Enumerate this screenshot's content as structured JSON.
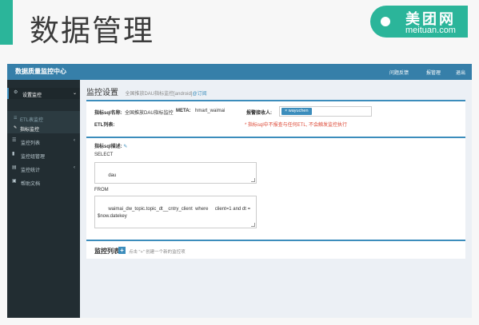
{
  "slide": {
    "title": "数据管理"
  },
  "logo": {
    "brand": "美团网",
    "domain": "meituan.com"
  },
  "app": {
    "title": "数据质量监控中心",
    "top_links": [
      "问题反馈",
      "报管理",
      "退出"
    ]
  },
  "sidebar": {
    "items": [
      {
        "label": "设置监控",
        "icon": "gear-icon"
      },
      {
        "label": "监控列表",
        "icon": "list-icon"
      },
      {
        "label": "监控组管理",
        "icon": "bookmark-icon"
      },
      {
        "label": "监控统计",
        "icon": "chart-icon"
      },
      {
        "label": "帮助文档",
        "icon": "document-icon"
      }
    ],
    "sub_items": [
      {
        "label": "ETL表监控",
        "icon": "table-icon"
      },
      {
        "label": "指标监控",
        "icon": "edit-icon"
      }
    ]
  },
  "page": {
    "title": "监控设置",
    "subtitle": "全国推放DAU指标监控[android]",
    "subtitle_link": "@订阅"
  },
  "form": {
    "sql_name_label": "指标sql名称:",
    "sql_name_value": "全国推放DAU指标监控",
    "meta_label": "META:",
    "meta_value": "hmart_waimai",
    "receiver_label": "报警接收人:",
    "receiver_tag": "× wayuchen",
    "etl_label": "ETL列表:",
    "warning": "* 指标sql中不报查与任何ETL, 不会触发监控执行"
  },
  "sql": {
    "desc_label": "指标sql描述:",
    "select_label": "SELECT",
    "select_value": "dau",
    "from_label": "FROM",
    "from_value": "waimai_dw_topic.topic_dt__cntry_client  where     client=1 and dt =\n$now.datekey"
  },
  "monitor_list": {
    "title": "监控列表",
    "add_symbol": "+",
    "hint": "点击 \"+\" 创建一个新的监控项"
  }
}
